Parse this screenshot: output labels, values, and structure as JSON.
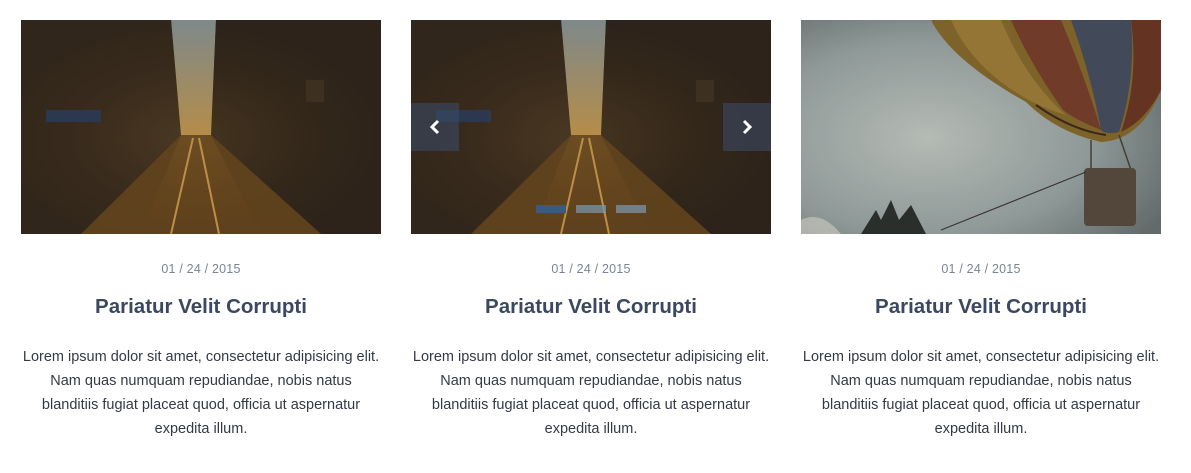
{
  "cards": [
    {
      "image": "street-sunset-photo",
      "date": "01 / 24 / 2015",
      "title": "Pariatur Velit Corrupti",
      "body": "Lorem ipsum dolor sit amet, consectetur adipisicing elit. Nam quas numquam repudiandae, nobis natus blanditiis fugiat placeat quod, officia ut aspernatur expedita illum."
    },
    {
      "image": "street-sunset-slider",
      "date": "01 / 24 / 2015",
      "title": "Pariatur Velit Corrupti",
      "body": "Lorem ipsum dolor sit amet, consectetur adipisicing elit. Nam quas numquam repudiandae, nobis natus blanditiis fugiat placeat quod, officia ut aspernatur expedita illum.",
      "slider": {
        "slides": 3,
        "active_index": 0,
        "prev_icon": "chevron-left-icon",
        "next_icon": "chevron-right-icon"
      }
    },
    {
      "image": "hot-air-balloon-photo",
      "date": "01 / 24 / 2015",
      "title": "Pariatur Velit Corrupti",
      "body": "Lorem ipsum dolor sit amet, consectetur adipisicing elit. Nam quas numquam repudiandae, nobis natus blanditiis fugiat placeat quod, officia ut aspernatur expedita illum."
    }
  ],
  "colors": {
    "title": "#3a4860",
    "date": "#7a8496",
    "body": "#333a44",
    "arrow_bg": "#3a4862",
    "dot_active": "#3a5a80",
    "dot_inactive": "#7896aa"
  }
}
